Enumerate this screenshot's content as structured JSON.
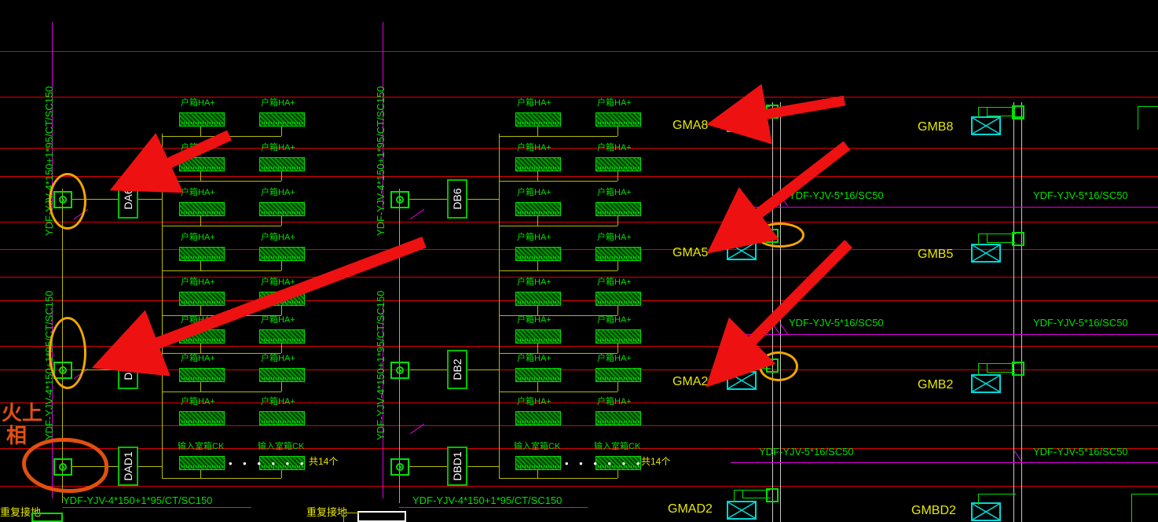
{
  "drawing": {
    "type": "electrical-riser-diagram",
    "background_color": "#000000",
    "grid_line_color": "#e00000",
    "bus_line_color": "#e000e0"
  },
  "cables": {
    "main_feeder_label": "YDF-YJV-4*150+1*95/CT/SC150",
    "branch_label": "YDF-YJV-5*16/SC50"
  },
  "vertical_feeders": [
    {
      "label": "YDF-YJV-4*150+1*95/CT/SC150"
    },
    {
      "label": "YDF-YJV-4*150+1*95/CT/SC150"
    },
    {
      "label": "YDF-YJV-4*150+1*95/CT/SC150"
    },
    {
      "label": "YDF-YJV-4*150+1*95/CT/SC150"
    }
  ],
  "riser_panels": [
    {
      "name": "DA6"
    },
    {
      "name": "DA2"
    },
    {
      "name": "DAD1"
    },
    {
      "name": "DB6"
    },
    {
      "name": "DB2"
    },
    {
      "name": "DBD1"
    }
  ],
  "meter_boxes_label": "户箱HA+",
  "bottom_box_label": "输入室箱CK",
  "bottom_counts": [
    {
      "text": "共14个"
    },
    {
      "text": "共14个"
    }
  ],
  "ground_label": "重复接地",
  "dots_symbol": "• • • • • •",
  "right_panels": [
    {
      "name": "GMA8",
      "cable": "YDF-YJV-5*16/SC50"
    },
    {
      "name": "GMB8",
      "cable": "YDF-YJV-5*16/SC50"
    },
    {
      "name": "GMA5",
      "cable": "YDF-YJV-5*16/SC50"
    },
    {
      "name": "GMB5",
      "cable": "YDF-YJV-5*16/SC50"
    },
    {
      "name": "GMA2",
      "cable": "YDF-YJV-5*16/SC50"
    },
    {
      "name": "GMB2",
      "cable": "YDF-YJV-5*16/SC50"
    },
    {
      "name": "GMAD2",
      "cable": ""
    },
    {
      "name": "GMBD2",
      "cable": ""
    }
  ],
  "bottom_cables": [
    {
      "text": "YDF-YJV-4*150+1*95/CT/SC150"
    },
    {
      "text": "YDF-YJV-4*150+1*95/CT/SC150"
    }
  ],
  "annotations": {
    "handwritten": [
      "火上",
      "相"
    ],
    "handwritten_color": "#e05010",
    "ellipse_color": "#f0a800",
    "arrow_color": "#ee1111",
    "arrow_count": 4,
    "ellipse_count": 4,
    "blob_count": 1
  }
}
